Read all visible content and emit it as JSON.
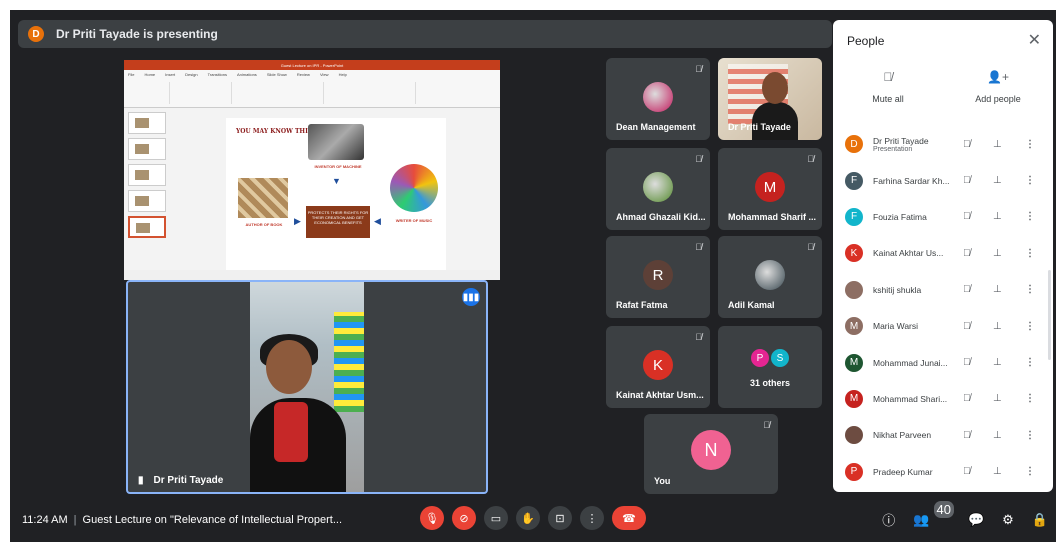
{
  "presenting_banner": {
    "avatar_letter": "D",
    "text": "Dr Priti Tayade is presenting"
  },
  "slide": {
    "window_title": "Guest Lecture on IPR - PowerPoint",
    "ribbon_tabs": [
      "File",
      "Home",
      "Insert",
      "Design",
      "Transitions",
      "Animations",
      "Slide Show",
      "Review",
      "View",
      "Help"
    ],
    "title": "YOU MAY KNOW THIS...",
    "label_machine": "INVENTOR OF MACHINE",
    "label_book": "AUTHOR OF BOOK",
    "label_music": "WRITER OF MUSIC",
    "box_text": "PROTECTS THEIR RIGHTS FOR THEIR CREATION AND GET ECONOMICAL BENEFITS"
  },
  "presenter_tile": {
    "name": "Dr Priti Tayade"
  },
  "tiles": [
    {
      "name": "Dean Management",
      "type": "photo",
      "color": "#c2185b"
    },
    {
      "name": "Dr Priti Tayade",
      "type": "video"
    },
    {
      "name": "Ahmad Ghazali Kid...",
      "type": "photo",
      "color": "#558b2f"
    },
    {
      "name": "Mohammad Sharif ...",
      "type": "letter",
      "letter": "M",
      "color": "#c5221f"
    },
    {
      "name": "Rafat Fatma",
      "type": "letter",
      "letter": "R",
      "color": "#5d4037"
    },
    {
      "name": "Adil Kamal",
      "type": "photo",
      "color": "#37474f"
    },
    {
      "name": "Kainat Akhtar Usm...",
      "type": "letter",
      "letter": "K",
      "color": "#d93025"
    },
    {
      "name": "31 others",
      "type": "others",
      "letters": [
        "P",
        "S"
      ],
      "colors": [
        "#e52592",
        "#12b5cb"
      ]
    },
    {
      "name": "You",
      "type": "letter",
      "letter": "N",
      "color": "#f06292"
    }
  ],
  "bottom_bar": {
    "time": "11:24 AM",
    "meeting_title": "Guest Lecture on \"Relevance of Intellectual Propert...",
    "participant_count": "40"
  },
  "people_panel": {
    "title": "People",
    "mute_all_label": "Mute all",
    "add_people_label": "Add people",
    "participants": [
      {
        "name": "Dr Priti Tayade",
        "sub": "Presentation",
        "letter": "D",
        "color": "#e8710a"
      },
      {
        "name": "Farhina Sardar Kh...",
        "letter": "F",
        "color": "#455a64"
      },
      {
        "name": "Fouzia Fatima",
        "letter": "F",
        "color": "#12b5cb"
      },
      {
        "name": "Kainat Akhtar Us...",
        "letter": "K",
        "color": "#d93025"
      },
      {
        "name": "kshitij shukla",
        "letter": "",
        "color": "#8d6e63"
      },
      {
        "name": "Maria Warsi",
        "letter": "M",
        "color": "#8d6e63"
      },
      {
        "name": "Mohammad Junai...",
        "letter": "M",
        "color": "#1e5631"
      },
      {
        "name": "Mohammad Shari...",
        "letter": "M",
        "color": "#c5221f"
      },
      {
        "name": "Nikhat Parveen",
        "letter": "",
        "color": "#6d4c41"
      },
      {
        "name": "Pradeep Kumar",
        "letter": "P",
        "color": "#d93025"
      }
    ]
  }
}
